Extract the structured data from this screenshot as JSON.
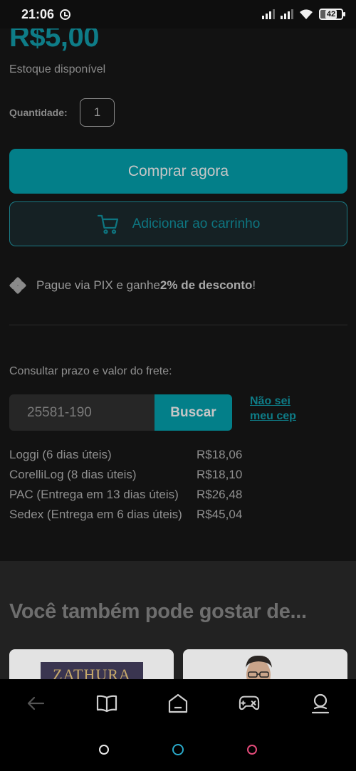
{
  "status_bar": {
    "time": "21:06",
    "battery": "42"
  },
  "product": {
    "price": "R$5,00",
    "stock": "Estoque disponível",
    "quantity_label": "Quantidade:",
    "quantity_value": "1"
  },
  "actions": {
    "buy_now": "Comprar agora",
    "add_to_cart": "Adicionar ao carrinho"
  },
  "pix": {
    "text_before": "Pague via PIX e ganhe ",
    "discount": "2% de desconto",
    "text_after": "!"
  },
  "shipping": {
    "title": "Consultar prazo e valor do frete:",
    "cep_value": "25581-190",
    "search_button": "Buscar",
    "dont_know_cep": "Não sei meu cep",
    "options": [
      {
        "name": "Loggi (6 dias úteis)",
        "price": "R$18,06"
      },
      {
        "name": "CorelliLog (8 dias úteis)",
        "price": "R$18,10"
      },
      {
        "name": "PAC (Entrega em 13 dias úteis)",
        "price": "R$26,48"
      },
      {
        "name": "Sedex (Entrega em 6 dias úteis)",
        "price": "R$45,04"
      }
    ]
  },
  "recommendations": {
    "title": "Você também pode gostar de...",
    "card1_book_title": "ZATHURA"
  },
  "bottom_nav": {
    "icons": [
      "back-arrow-icon",
      "book-icon",
      "home-icon",
      "gamepad-icon",
      "profile-icon"
    ]
  },
  "colors": {
    "accent": "#037f89",
    "background": "#121212"
  }
}
